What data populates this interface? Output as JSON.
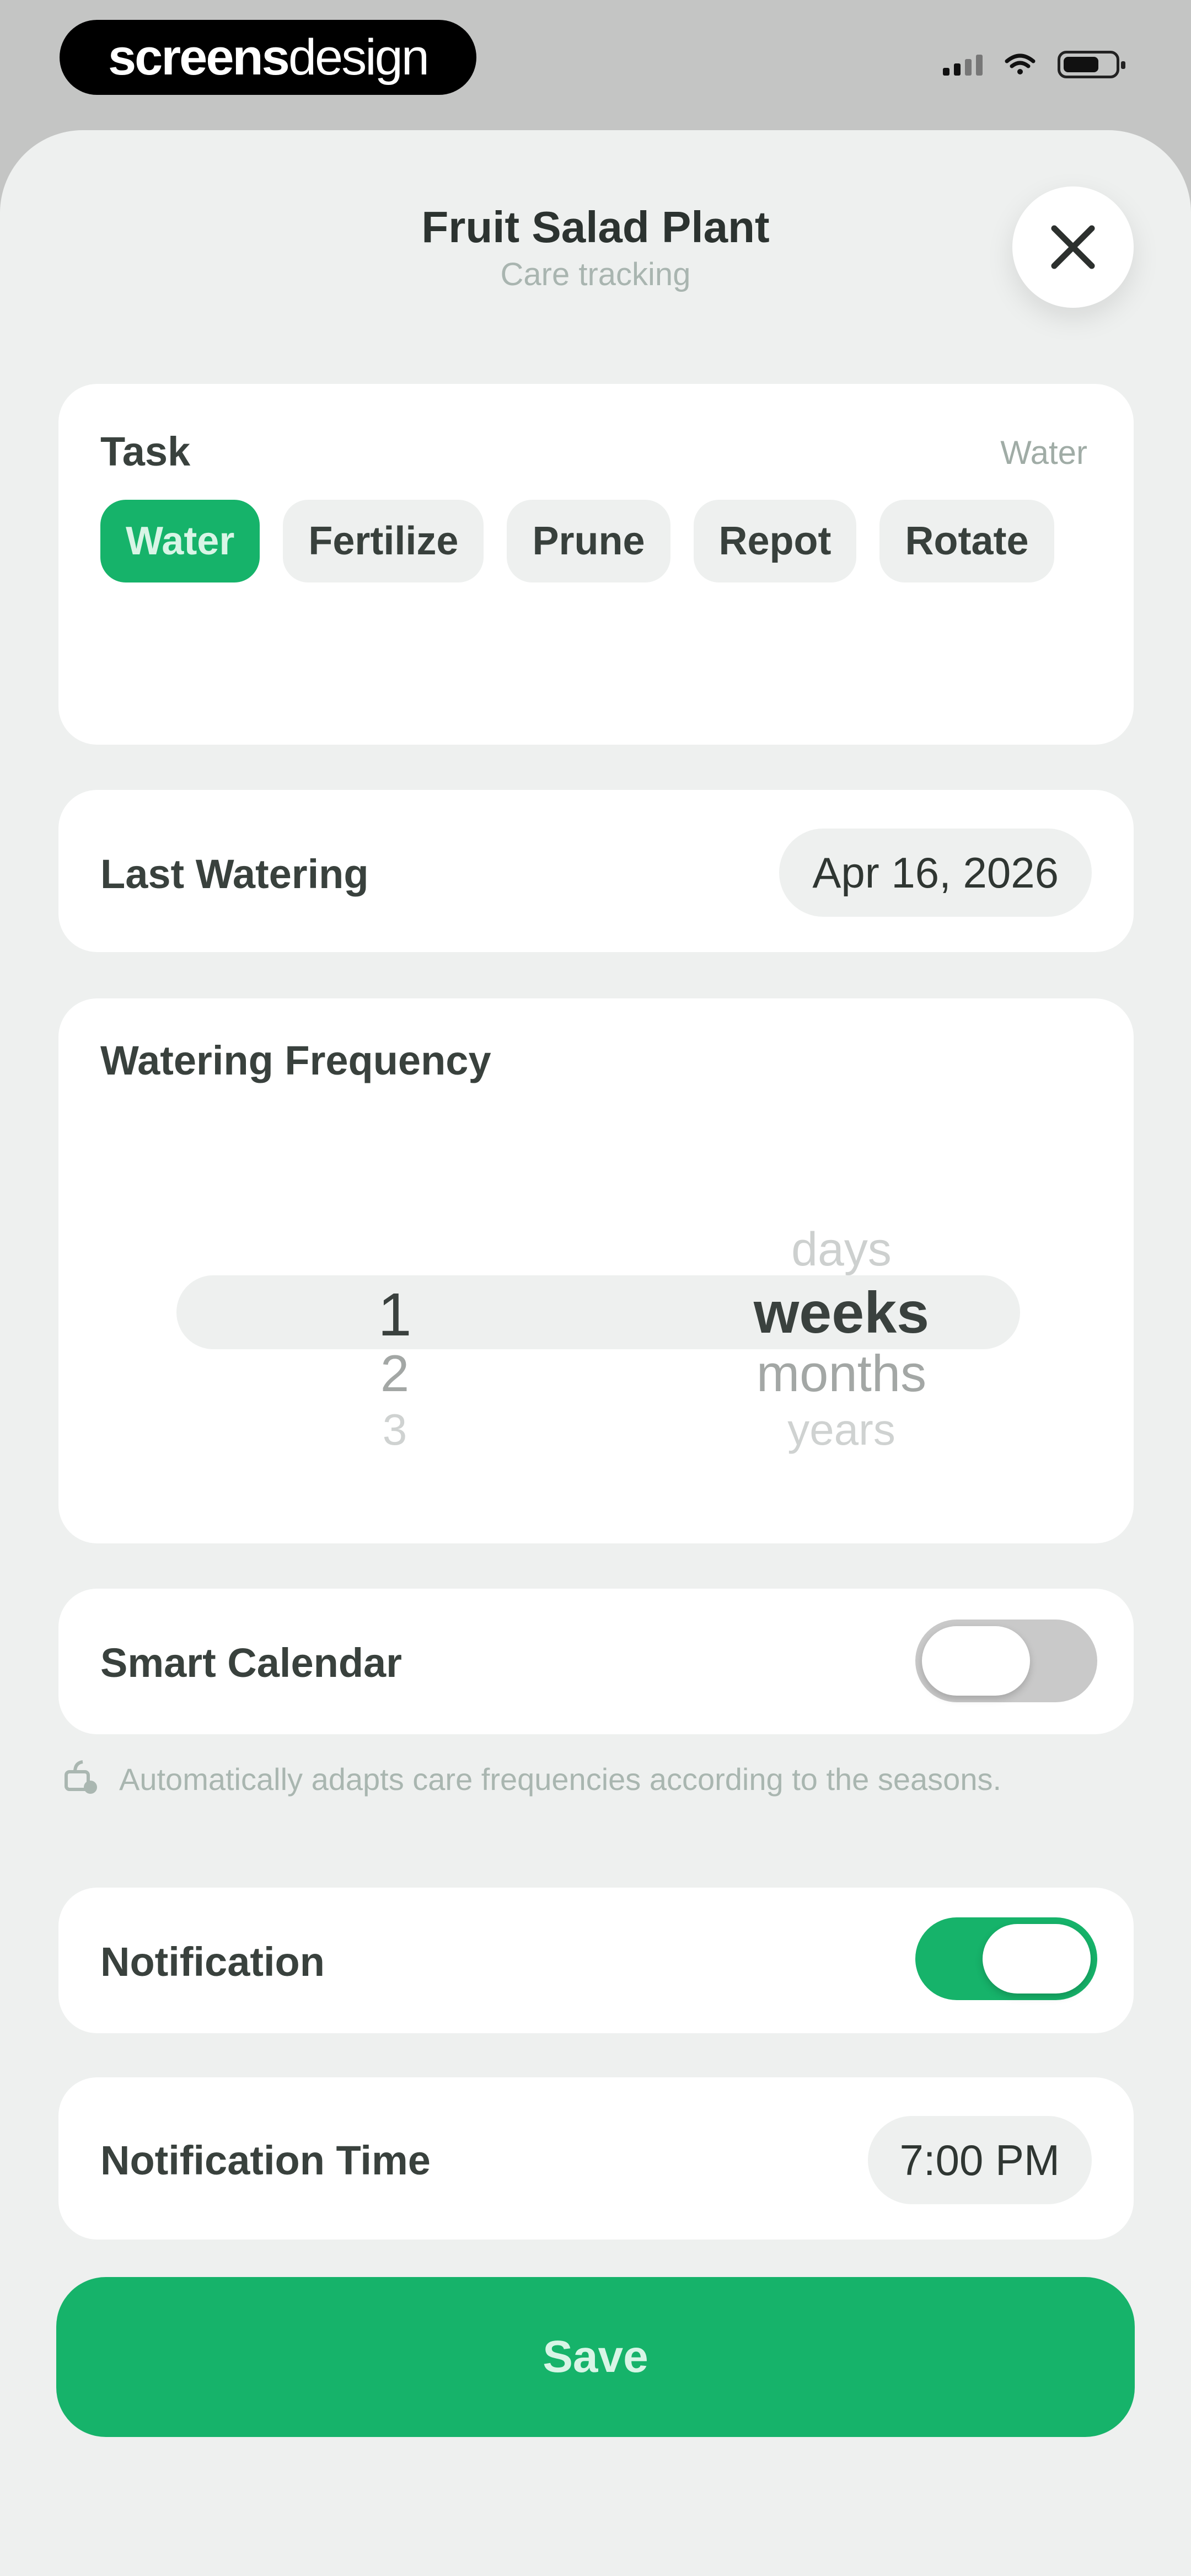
{
  "status_bar": {
    "brand_bold": "screens",
    "brand_light": "design",
    "icons": [
      "signal-icon",
      "wifi-icon",
      "battery-icon"
    ]
  },
  "header": {
    "title": "Fruit Salad Plant",
    "subtitle": "Care tracking",
    "close_icon": "close-icon"
  },
  "task": {
    "label": "Task",
    "selected_value": "Water",
    "chips": [
      {
        "label": "Water",
        "active": true
      },
      {
        "label": "Fertilize",
        "active": false
      },
      {
        "label": "Prune",
        "active": false
      },
      {
        "label": "Repot",
        "active": false
      },
      {
        "label": "Rotate",
        "active": false
      }
    ]
  },
  "last_watering": {
    "label": "Last Watering",
    "value": "Apr 16, 2026"
  },
  "frequency": {
    "label": "Watering Frequency",
    "numbers": [
      "1",
      "2",
      "3"
    ],
    "selected_number": "1",
    "units": [
      "days",
      "weeks",
      "months",
      "years"
    ],
    "selected_unit": "weeks"
  },
  "smart_calendar": {
    "label": "Smart Calendar",
    "enabled": false,
    "hint": "Automatically adapts care frequencies according to the seasons."
  },
  "notification": {
    "label": "Notification",
    "enabled": true
  },
  "notification_time": {
    "label": "Notification Time",
    "value": "7:00 PM"
  },
  "save_button": {
    "label": "Save"
  },
  "colors": {
    "accent": "#16b36a",
    "sheet_bg": "#eef0ef",
    "card_bg": "#ffffff",
    "toggle_off": "#c9c9c9"
  }
}
